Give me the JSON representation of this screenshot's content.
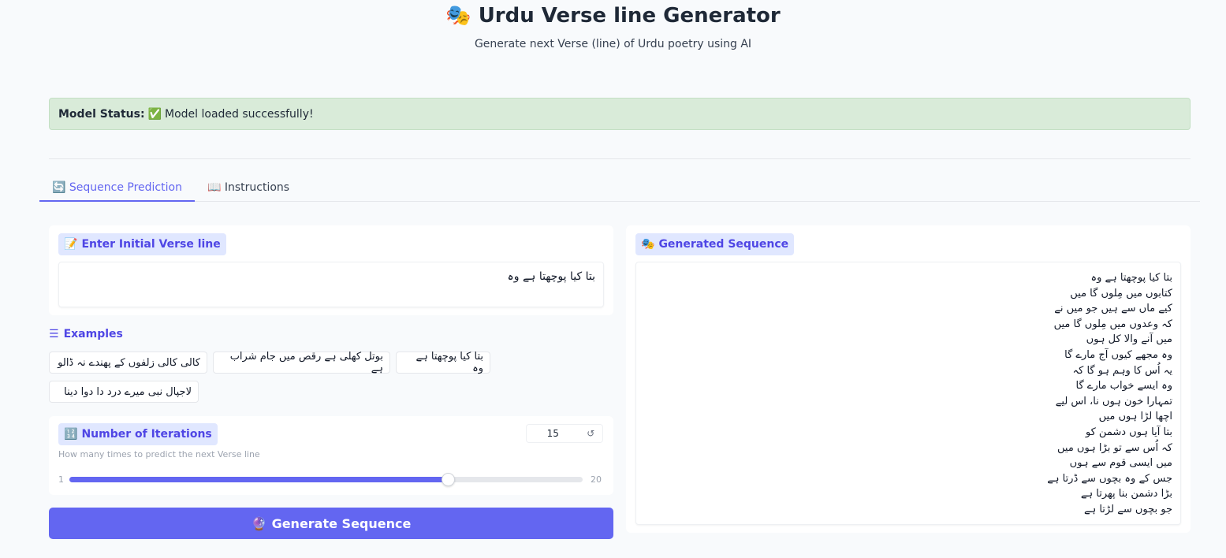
{
  "header": {
    "icon": "🎭",
    "title": "Urdu Verse line Generator",
    "subtitle": "Generate next Verse (line) of Urdu poetry using AI"
  },
  "status": {
    "label": "Model Status:",
    "icon": "✅",
    "text": "Model loaded successfully!",
    "bg_color": "#d9ebd9"
  },
  "tabs": [
    {
      "icon": "🔄",
      "label": "Sequence Prediction",
      "active": true
    },
    {
      "icon": "📖",
      "label": "Instructions",
      "active": false
    }
  ],
  "input": {
    "icon": "📝",
    "label": "Enter Initial Verse line",
    "value": "بتا کیا پوچھتا ہے وہ"
  },
  "examples": {
    "icon": "☰",
    "label": "Examples",
    "items": [
      "بتا کیا پوچھتا ہے وہ",
      "بوتل کھلی ہے رقص میں جام شراب ہے",
      "کالی کالی زلفوں کے پھندے نہ ڈالو",
      "لاجپال نبی میرے درد دا دوا دینا"
    ]
  },
  "iterations": {
    "icon": "🔢",
    "label": "Number of Iterations",
    "hint": "How many times to predict the next Verse line",
    "value": 15,
    "min": 1,
    "max": 20,
    "reset_icon": "↺"
  },
  "generate": {
    "icon": "🔮",
    "label": "Generate Sequence"
  },
  "output": {
    "icon": "🎭",
    "label": "Generated Sequence",
    "lines": [
      "بتا کیا پوچھتا ہے وہ",
      "کتابوں میں مِلوں گا میں",
      "کیے ماں سے ہیں جو میں نے",
      "کہ وعدوں میں مِلوں گا میں",
      "میں آنے والا کل ہوں",
      "وہ مجھے کیوں آج مارے گا",
      "یہ اُس کا وہم ہو گا کہ",
      "وہ ایسے خواب مارے گا",
      "تمہارا خون ہوں نا، اس لیے",
      "اچھا لڑا ہوں میں",
      "بتا آیا ہوں دشمن کو",
      "کہ اُس سے تو بڑا ہوں میں",
      "میں ایسی قوم سے ہوں",
      "جس کے وہ بچوں سے ڈرتا ہے",
      "بڑا دشمن بنا پھرتا ہے",
      "جو بچوں سے لڑتا ہے"
    ]
  },
  "colors": {
    "accent": "#6366f1",
    "accent_light": "#e0e7ff",
    "background": "#f8fafc"
  }
}
